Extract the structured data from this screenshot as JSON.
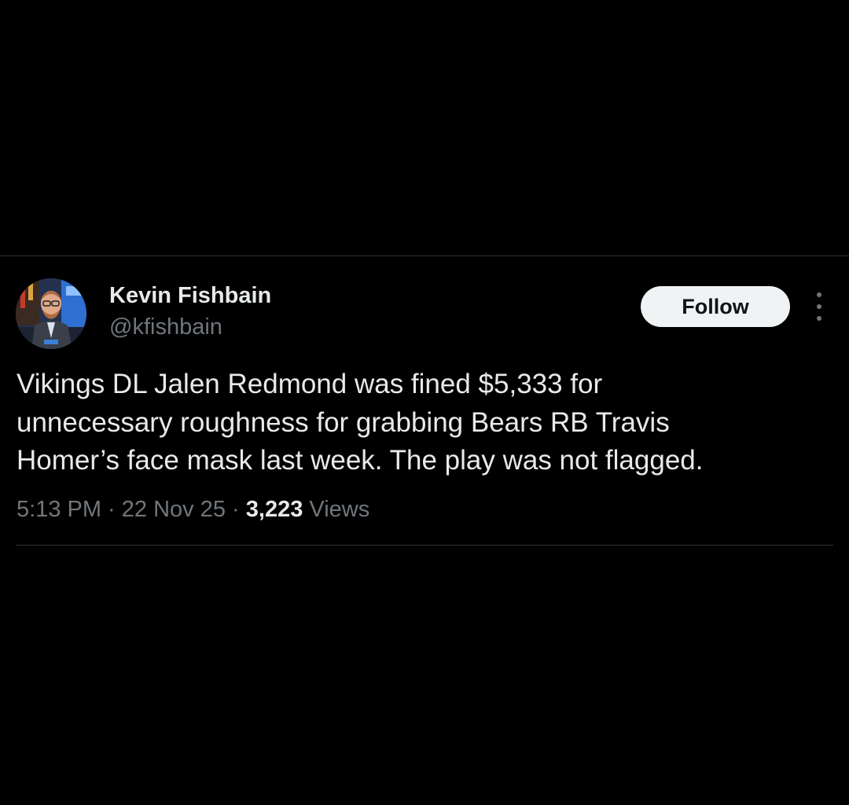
{
  "author": {
    "display_name": "Kevin Fishbain",
    "handle": "@kfishbain",
    "avatar_icon": "profile-photo"
  },
  "actions": {
    "follow_label": "Follow",
    "more_icon": "more-vertical-icon"
  },
  "tweet": {
    "lines": [
      "Vikings DL Jalen Redmond was fined $5,333 for",
      "unnecessary roughness for grabbing Bears RB Travis",
      "Homer’s face mask last week. The play was not flagged."
    ]
  },
  "meta": {
    "time": "5:13 PM",
    "separator": " · ",
    "date": "22 Nov 25",
    "views_count": "3,223",
    "views_label": " Views"
  },
  "colors": {
    "background": "#000000",
    "text_primary": "#e7e9ea",
    "text_secondary": "#71767b",
    "follow_bg": "#eff3f4",
    "follow_text": "#0f1419",
    "divider": "#2f3336"
  }
}
